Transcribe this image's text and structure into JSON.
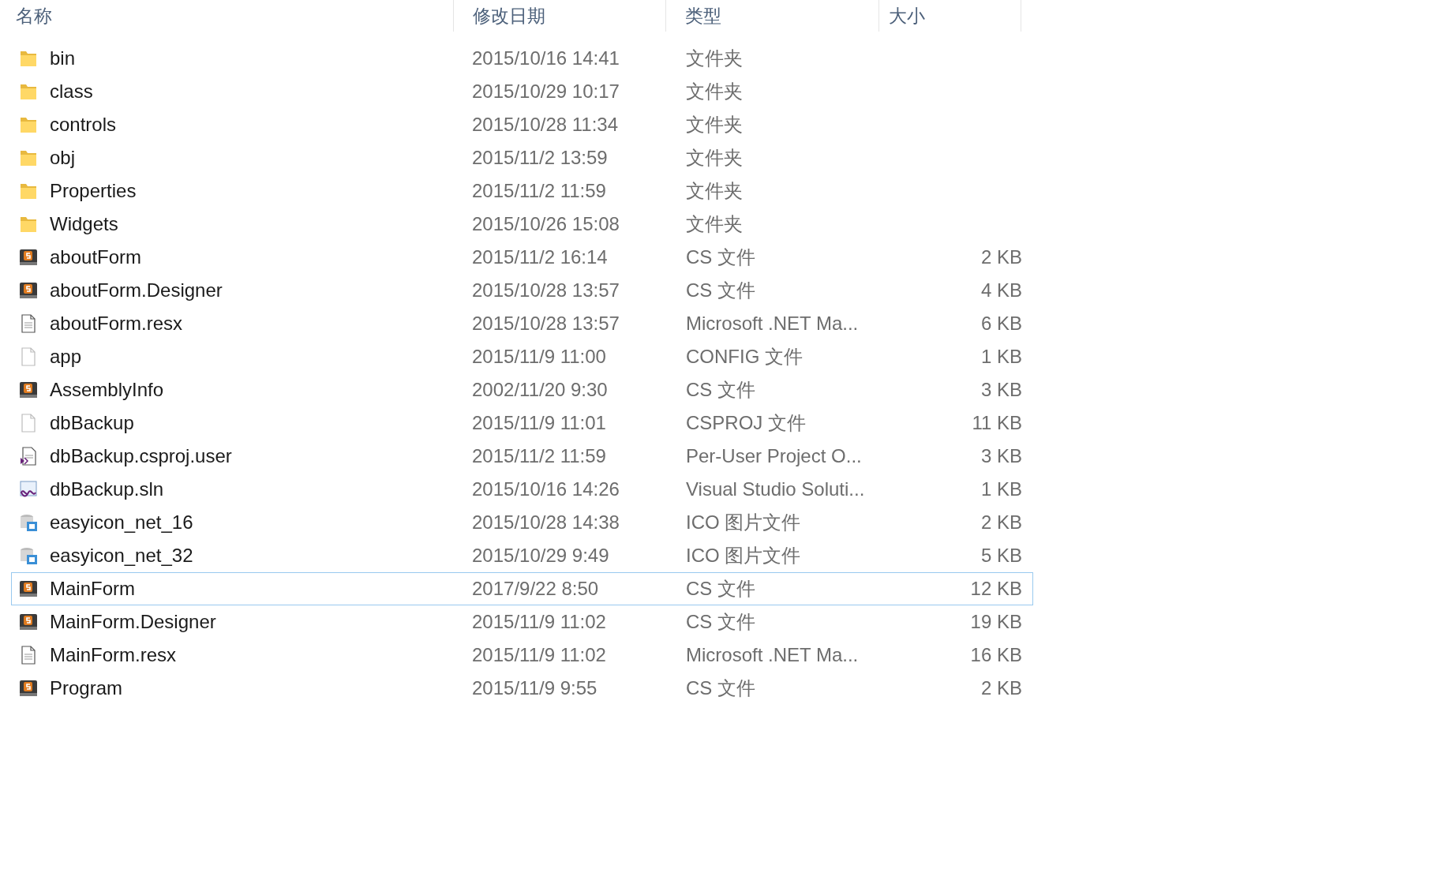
{
  "columns": [
    "名称",
    "修改日期",
    "类型",
    "大小"
  ],
  "files": [
    {
      "name": "bin",
      "date": "2015/10/16 14:41",
      "type": "文件夹",
      "kind": "folder",
      "selected": false
    },
    {
      "name": "class",
      "date": "2015/10/29 10:17",
      "type": "文件夹",
      "kind": "folder",
      "selected": false
    },
    {
      "name": "controls",
      "date": "2015/10/28 11:34",
      "type": "文件夹",
      "kind": "folder",
      "selected": false
    },
    {
      "name": "obj",
      "date": "2015/11/2 13:59",
      "type": "文件夹",
      "kind": "folder",
      "selected": false
    },
    {
      "name": "Properties",
      "date": "2015/11/2 11:59",
      "type": "文件夹",
      "kind": "folder",
      "selected": false
    },
    {
      "name": "Widgets",
      "date": "2015/10/26 15:08",
      "type": "文件夹",
      "kind": "folder",
      "selected": false
    },
    {
      "name": "aboutForm",
      "date": "2015/11/2 16:14",
      "type": "CS 文件",
      "size": "2 KB",
      "kind": "cs",
      "selected": false
    },
    {
      "name": "aboutForm.Designer",
      "date": "2015/10/28 13:57",
      "type": "CS 文件",
      "size": "4 KB",
      "kind": "cs",
      "selected": false
    },
    {
      "name": "aboutForm.resx",
      "date": "2015/10/28 13:57",
      "type": "Microsoft .NET Ma...",
      "size": "6 KB",
      "kind": "doc",
      "selected": false
    },
    {
      "name": "app",
      "date": "2015/11/9 11:00",
      "type": "CONFIG 文件",
      "size": "1 KB",
      "kind": "blank",
      "selected": false
    },
    {
      "name": "AssemblyInfo",
      "date": "2002/11/20 9:30",
      "type": "CS 文件",
      "size": "3 KB",
      "kind": "cs",
      "selected": false
    },
    {
      "name": "dbBackup",
      "date": "2015/11/9 11:01",
      "type": "CSPROJ 文件",
      "size": "11 KB",
      "kind": "blank",
      "selected": false
    },
    {
      "name": "dbBackup.csproj.user",
      "date": "2015/11/2 11:59",
      "type": "Per-User Project O...",
      "size": "3 KB",
      "kind": "user",
      "selected": false
    },
    {
      "name": "dbBackup.sln",
      "date": "2015/10/16 14:26",
      "type": "Visual Studio Soluti...",
      "size": "1 KB",
      "kind": "sln",
      "selected": false
    },
    {
      "name": "easyicon_net_16",
      "date": "2015/10/28 14:38",
      "type": "ICO 图片文件",
      "size": "2 KB",
      "kind": "ico",
      "selected": false
    },
    {
      "name": "easyicon_net_32",
      "date": "2015/10/29 9:49",
      "type": "ICO 图片文件",
      "size": "5 KB",
      "kind": "ico",
      "selected": false
    },
    {
      "name": "MainForm",
      "date": "2017/9/22 8:50",
      "type": "CS 文件",
      "size": "12 KB",
      "kind": "cs",
      "selected": true
    },
    {
      "name": "MainForm.Designer",
      "date": "2015/11/9 11:02",
      "type": "CS 文件",
      "size": "19 KB",
      "kind": "cs",
      "selected": false
    },
    {
      "name": "MainForm.resx",
      "date": "2015/11/9 11:02",
      "type": "Microsoft .NET Ma...",
      "size": "16 KB",
      "kind": "doc",
      "selected": false
    },
    {
      "name": "Program",
      "date": "2015/11/9 9:55",
      "type": "CS 文件",
      "size": "2 KB",
      "kind": "cs",
      "selected": false
    }
  ]
}
